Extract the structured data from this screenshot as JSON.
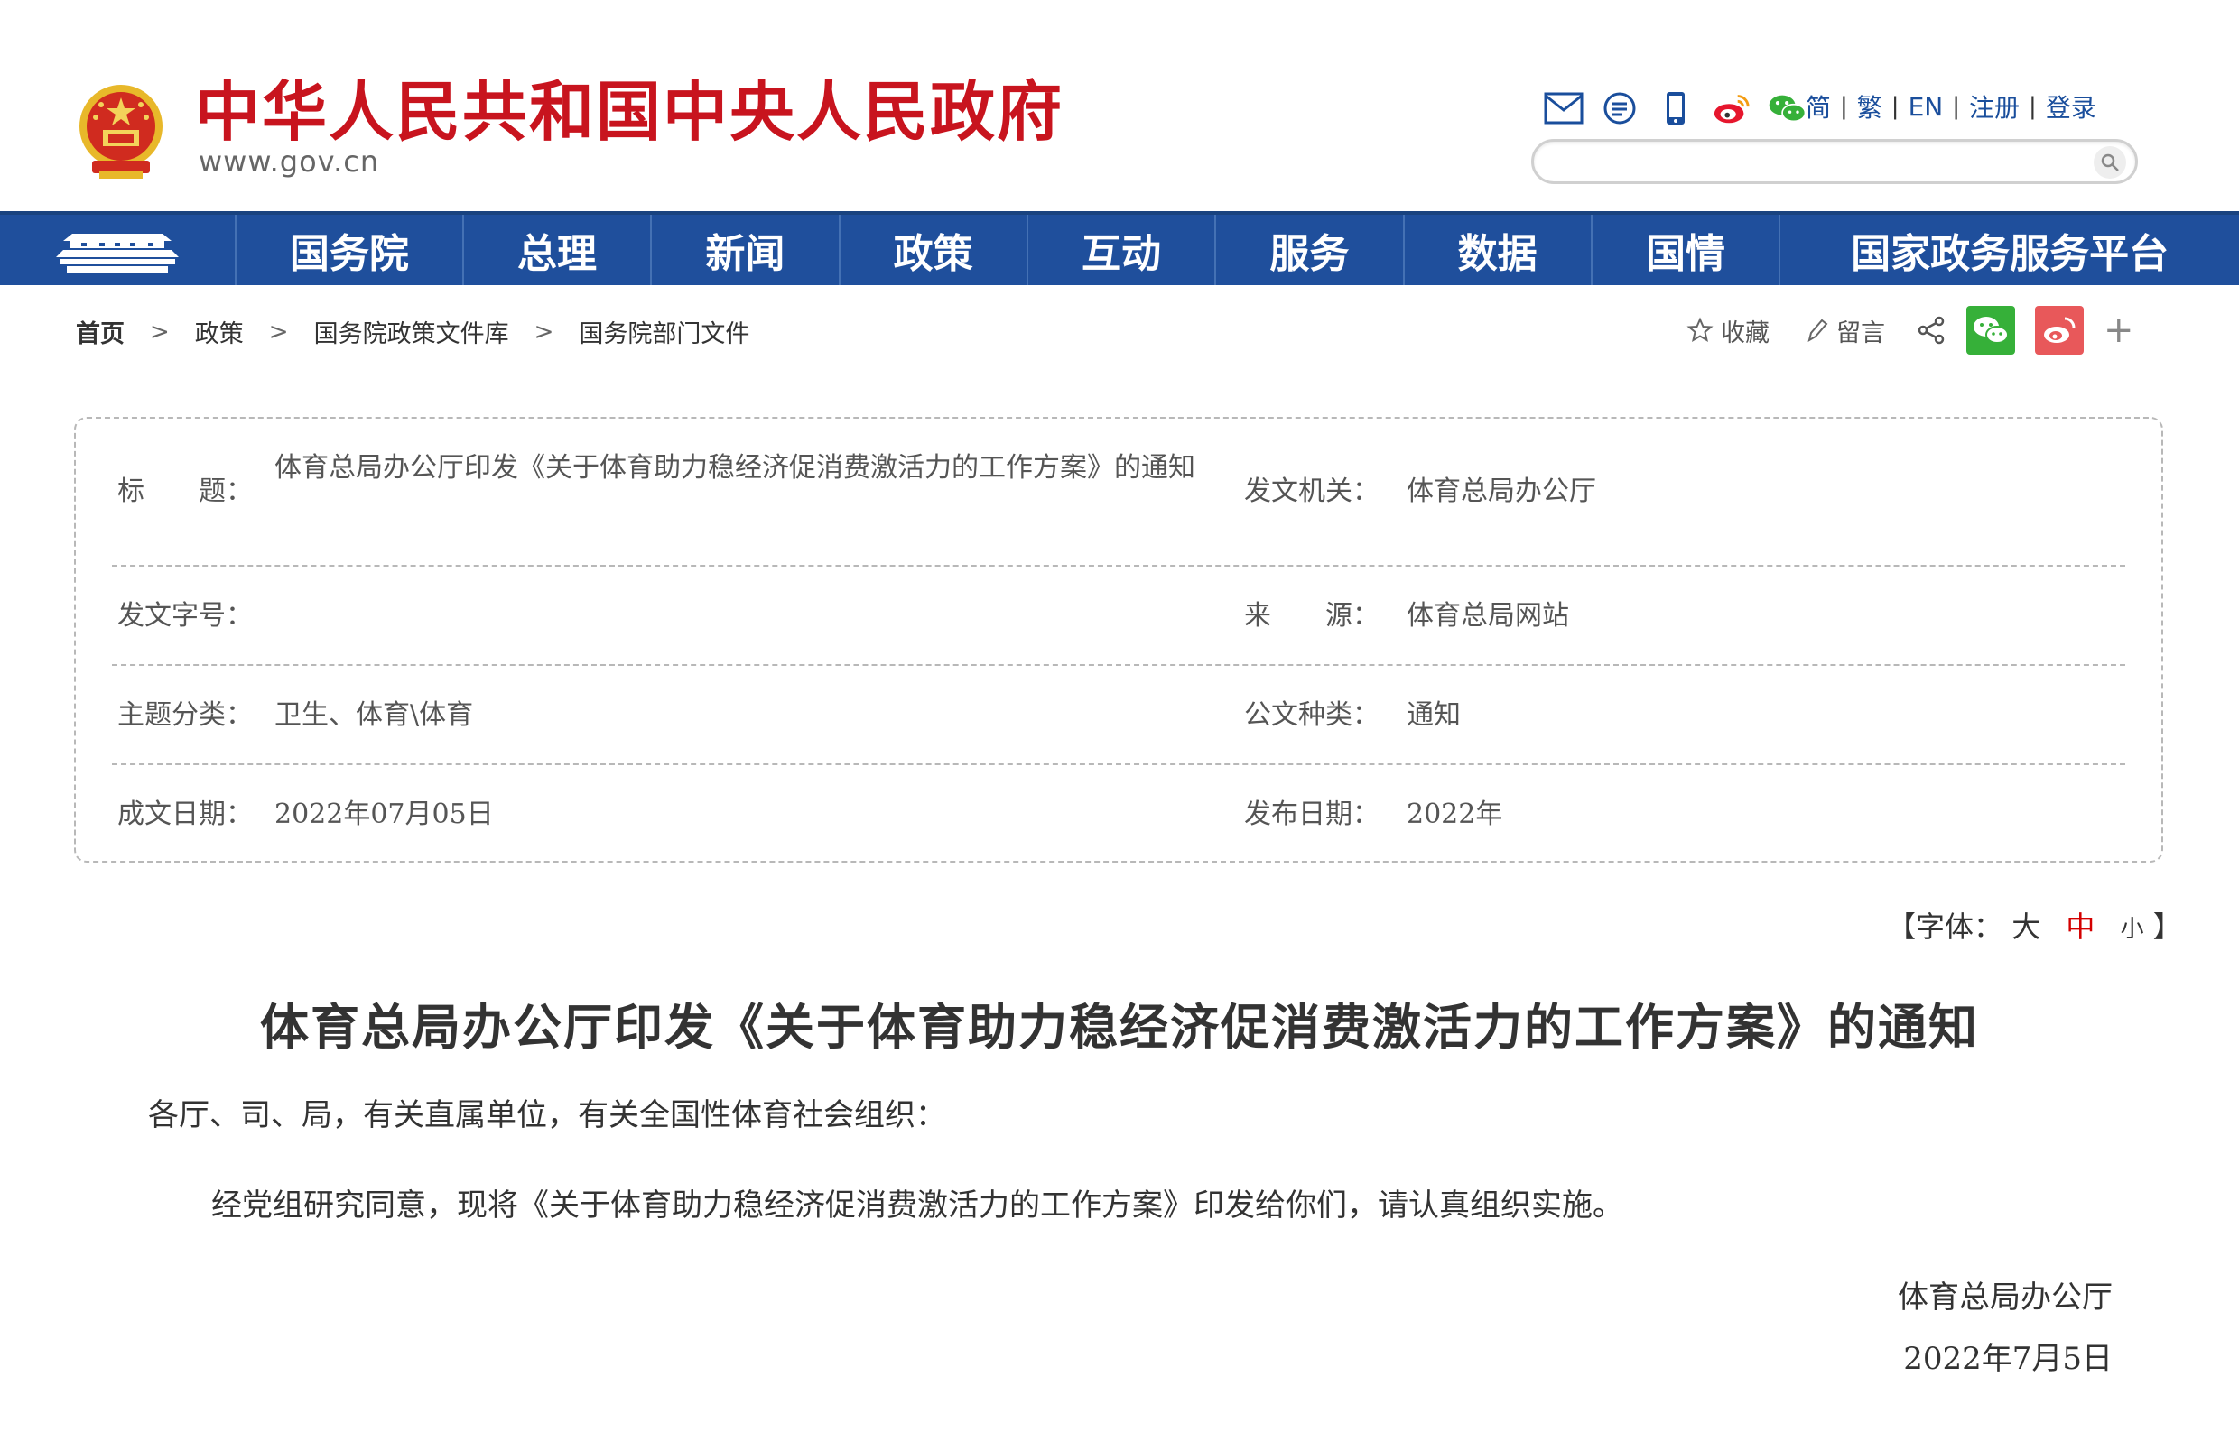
{
  "header": {
    "site_title": "中华人民共和国中央人民政府",
    "site_url": "www.gov.cn",
    "icons": [
      "mail-icon",
      "message-icon",
      "mobile-icon",
      "weibo-icon",
      "wechat-icon"
    ],
    "lang_links": [
      "简",
      "繁",
      "EN",
      "注册",
      "登录"
    ],
    "search_placeholder": ""
  },
  "nav": {
    "items": [
      "国务院",
      "总理",
      "新闻",
      "政策",
      "互动",
      "服务",
      "数据",
      "国情",
      "国家政务服务平台"
    ]
  },
  "breadcrumb": [
    "首页",
    "政策",
    "国务院政策文件库",
    "国务院部门文件"
  ],
  "share": {
    "favorite_label": "收藏",
    "comment_label": "留言"
  },
  "meta": {
    "title_label": "标　　题：",
    "title_value": "体育总局办公厅印发《关于体育助力稳经济促消费激活力的工作方案》的通知",
    "issuer_label": "发文机关：",
    "issuer_value": "体育总局办公厅",
    "doc_no_label": "发文字号：",
    "doc_no_value": "",
    "source_label": "来　　源：",
    "source_value": "体育总局网站",
    "topic_label": "主题分类：",
    "topic_value": "卫生、体育\\体育",
    "doc_type_label": "公文种类：",
    "doc_type_value": "通知",
    "written_date_label": "成文日期：",
    "written_date_value": "2022年07月05日",
    "publish_date_label": "发布日期：",
    "publish_date_value": "2022年"
  },
  "font_size": {
    "open": "【字体：",
    "large": "大",
    "medium": "中",
    "small": "小",
    "close": "】"
  },
  "article": {
    "title": "体育总局办公厅印发《关于体育助力稳经济促消费激活力的工作方案》的通知",
    "addressee": "各厅、司、局，有关直属单位，有关全国性体育社会组织：",
    "paragraph": "经党组研究同意，现将《关于体育助力稳经济促消费激活力的工作方案》印发给你们，请认真组织实施。",
    "signature_org": "体育总局办公厅",
    "signature_date": "2022年7月5日"
  },
  "colors": {
    "brand_red": "#c8141e",
    "nav_blue": "#1f4f9c",
    "link_blue": "#1a4e9c",
    "wechat_green": "#36b039",
    "weibo_red": "#e8585a"
  }
}
